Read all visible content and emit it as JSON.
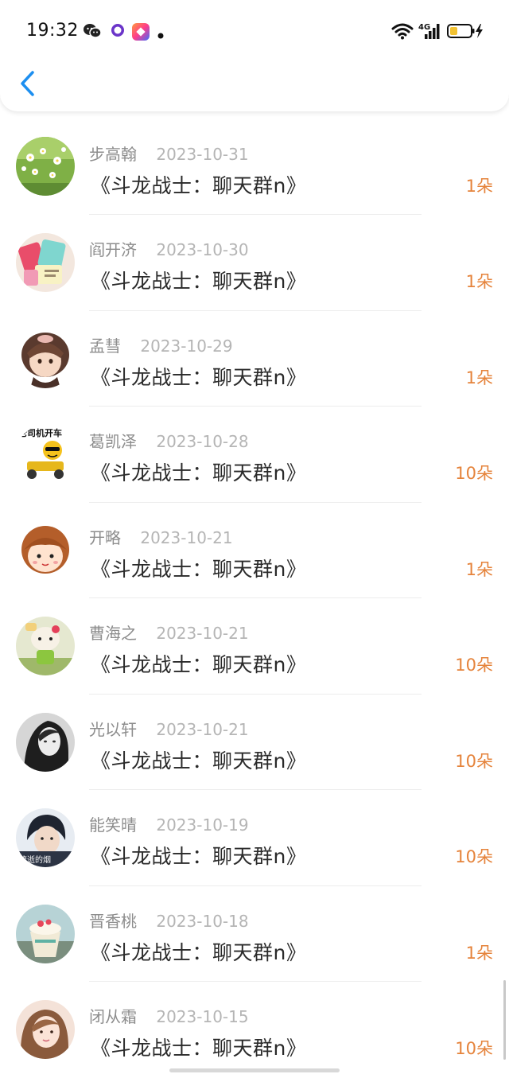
{
  "status_bar": {
    "time": "19:32",
    "notification_icons": [
      "wechat-icon",
      "chat-app-icon",
      "app-store-icon",
      "dot-icon"
    ],
    "signal_text": "4G"
  },
  "colors": {
    "accent_blue": "#1d8ff0",
    "amount_orange": "#e5833b"
  },
  "records": [
    {
      "name": "步高翰",
      "date": "2023-10-31",
      "title": "《斗龙战士：聊天群n》",
      "amount": "1朵"
    },
    {
      "name": "阎开济",
      "date": "2023-10-30",
      "title": "《斗龙战士：聊天群n》",
      "amount": "1朵"
    },
    {
      "name": "孟彗",
      "date": "2023-10-29",
      "title": "《斗龙战士：聊天群n》",
      "amount": "1朵"
    },
    {
      "name": "葛凯泽",
      "date": "2023-10-28",
      "title": "《斗龙战士：聊天群n》",
      "amount": "10朵",
      "avatar_text": "老司机开车"
    },
    {
      "name": "开略",
      "date": "2023-10-21",
      "title": "《斗龙战士：聊天群n》",
      "amount": "1朵"
    },
    {
      "name": "曹海之",
      "date": "2023-10-21",
      "title": "《斗龙战士：聊天群n》",
      "amount": "10朵"
    },
    {
      "name": "光以轩",
      "date": "2023-10-21",
      "title": "《斗龙战士：聊天群n》",
      "amount": "10朵"
    },
    {
      "name": "能笑晴",
      "date": "2023-10-19",
      "title": "《斗龙战士：聊天群n》",
      "amount": "10朵",
      "avatar_text": "流逝的烟"
    },
    {
      "name": "晋香桃",
      "date": "2023-10-18",
      "title": "《斗龙战士：聊天群n》",
      "amount": "1朵"
    },
    {
      "name": "闭从霜",
      "date": "2023-10-15",
      "title": "《斗龙战士：聊天群n》",
      "amount": "10朵"
    }
  ]
}
